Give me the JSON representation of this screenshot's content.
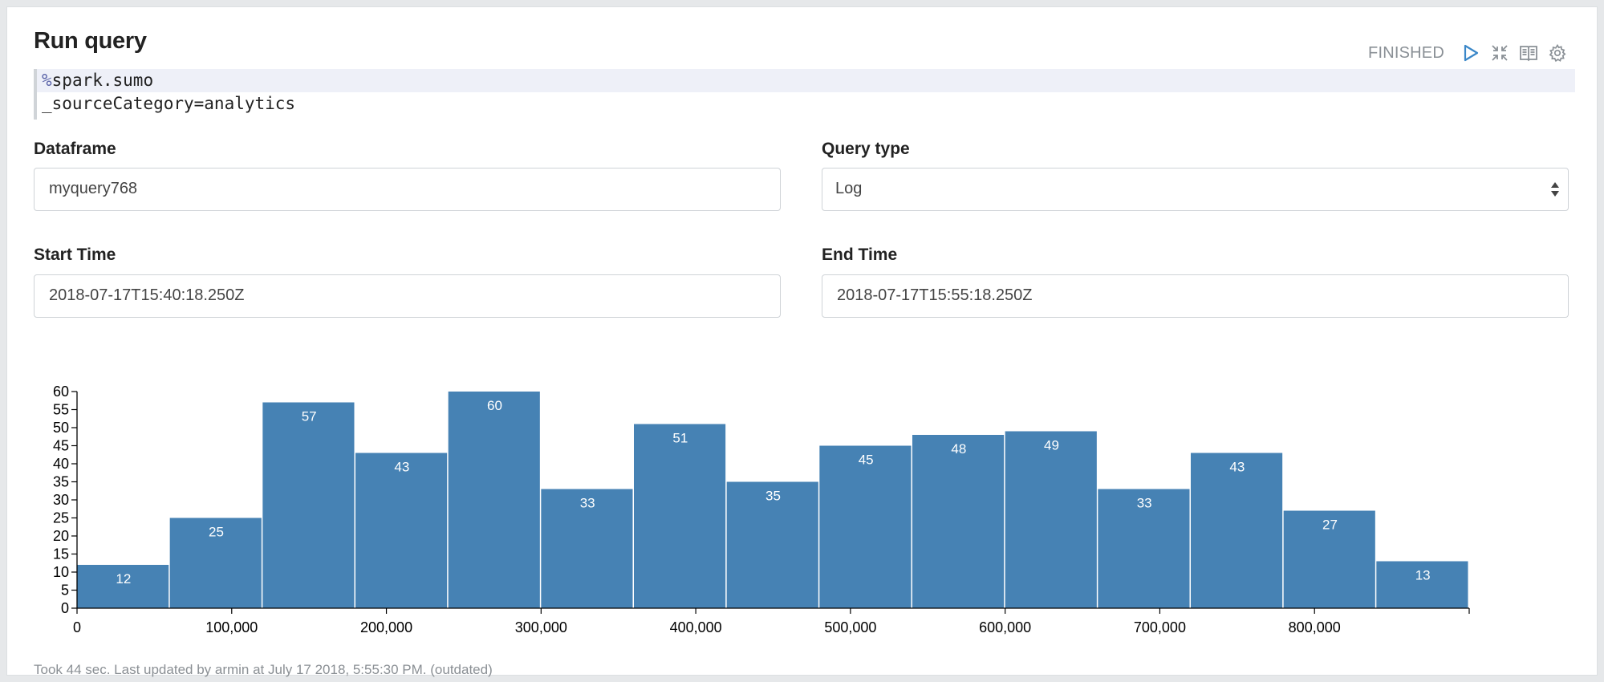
{
  "paragraph": {
    "title": "Run query",
    "status": "FINISHED"
  },
  "toolbar": {
    "icons": [
      "run-icon",
      "collapse-icon",
      "book-icon",
      "gear-icon"
    ]
  },
  "code": {
    "line1_magic": "%",
    "line1_rest": "spark.sumo",
    "line2": "_sourceCategory=analytics"
  },
  "form": {
    "dataframe_label": "Dataframe",
    "dataframe_value": "myquery768",
    "query_type_label": "Query type",
    "query_type_value": "Log",
    "start_label": "Start Time",
    "start_value": "2018-07-17T15:40:18.250Z",
    "end_label": "End Time",
    "end_value": "2018-07-17T15:55:18.250Z"
  },
  "chart_data": {
    "type": "bar",
    "bin_width": 60000,
    "x": [
      0,
      60000,
      120000,
      180000,
      240000,
      300000,
      360000,
      420000,
      480000,
      540000,
      600000,
      660000,
      720000,
      780000,
      840000
    ],
    "values": [
      12,
      25,
      57,
      43,
      60,
      33,
      51,
      35,
      45,
      48,
      49,
      33,
      43,
      27,
      13
    ],
    "xlim": [
      0,
      900000
    ],
    "ylim": [
      0,
      60
    ],
    "x_ticks": [
      0,
      100000,
      200000,
      300000,
      400000,
      500000,
      600000,
      700000,
      800000
    ],
    "x_tick_labels": [
      "0",
      "100,000",
      "200,000",
      "300,000",
      "400,000",
      "500,000",
      "600,000",
      "700,000",
      "800,000"
    ],
    "y_ticks": [
      0,
      5,
      10,
      15,
      20,
      25,
      30,
      35,
      40,
      45,
      50,
      55,
      60
    ],
    "bar_color": "#4682b4",
    "grid": false
  },
  "footer": {
    "text": "Took 44 sec. Last updated by armin at July 17 2018, 5:55:30 PM. (outdated)"
  }
}
